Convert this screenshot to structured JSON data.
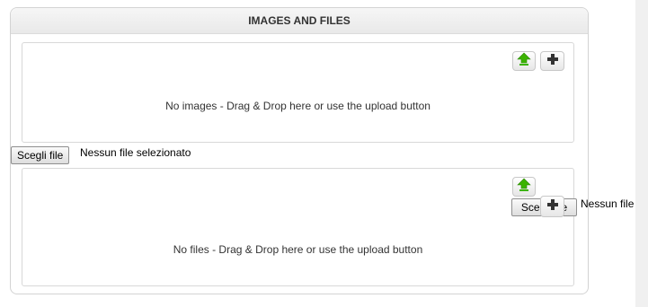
{
  "panel": {
    "title": "IMAGES AND FILES"
  },
  "images": {
    "empty_text": "No images - Drag & Drop here or use the upload button",
    "upload_icon": "upload-arrow-icon",
    "add_icon": "plus-icon"
  },
  "file_input_1": {
    "button_label": "Scegli file",
    "status": "Nessun file selezionato"
  },
  "files": {
    "empty_text": "No files - Drag & Drop here or use the upload button",
    "upload_icon": "upload-arrow-icon",
    "add_icon": "plus-icon"
  },
  "file_input_2": {
    "button_label": "Scegli file",
    "status": "Nessun file selezionato"
  },
  "colors": {
    "upload_arrow": "#3bb300",
    "plus": "#333333"
  }
}
